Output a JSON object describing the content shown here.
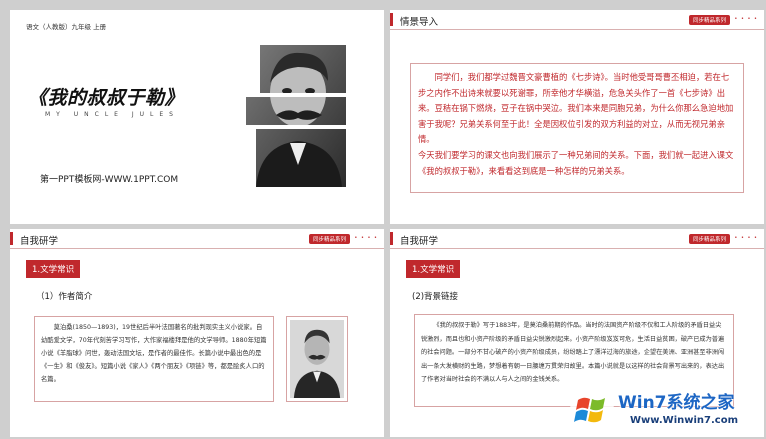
{
  "slide1": {
    "course": "语文（人教版）九年级 上册",
    "title": "《我的叔叔于勒》",
    "subtitle": "MY UNCLE JULES",
    "site": "第一PPT模板网-WWW.1PPT.COM"
  },
  "slide2": {
    "header": "情景导入",
    "badge": "同步精品系列",
    "para1": "同学们，我们都学过魏晋文豪曹植的《七步诗》。当时他受哥哥曹丕相迫，若在七步之内作不出诗来就要以死谢罪，所幸他才华横溢，危急关头作了一首《七步诗》出来。豆秸在锅下燃烧，豆子在锅中哭泣。我们本来是同胞兄弟，为什么你那么急迫地加害于我呢？兄弟关系何至于此！全是因权位引发的双方利益的对立，从而无视兄弟亲情。",
    "para2": "今天我们要学习的课文也向我们展示了一种兄弟间的关系。下面，我们就一起进入课文《我的叔叔于勒》，来看看这到底是一种怎样的兄弟关系。"
  },
  "slide3": {
    "header": "自我研学",
    "badge": "同步精品系列",
    "tab": "1.文学常识",
    "subhead": "（1）作者简介",
    "body": "莫泊桑(1850—1893)，19世纪后半叶法国著名的批判现实主义小说家。自幼酷爱文学，70年代刻苦学习写作，大作家福楼拜是他的文学导师。1880年短篇小说《羊脂球》问世，轰动法国文坛，是作者的最佳作。长篇小说中最出色的是《一生》和《俊友》。短篇小说《家人》《两个朋友》《项链》等，都是脍炙人口的名篇。"
  },
  "slide4": {
    "header": "自我研学",
    "badge": "同步精品系列",
    "tab": "1.文学常识",
    "subhead": "(2)背景链接",
    "body": "《我的叔叔于勒》写于1883年，是莫泊桑前期的作品。当时的法国资产阶级不仅和工人阶级的矛盾日益尖锐激烈，而且也和小资产阶级的矛盾日益尖锐激烈起来。小资产阶级岌岌可危，生活日益贫困，破产已成为普遍的社会问题。一部分不甘心破产的小资产阶级成员，纷纷踏上了漂洋过海的旅途，企望在美洲、亚洲甚至非洲闯出一条大发横财的生路，梦想着有朝一日腰缠万贯荣归故里。本篇小说就是以这样的社会背景写出来的，表达出了作者对当时社会的不满以人与人之间的金钱关系。"
  },
  "watermark": {
    "name": "Win7系统之家",
    "url": "Www.Winwin7.com"
  }
}
